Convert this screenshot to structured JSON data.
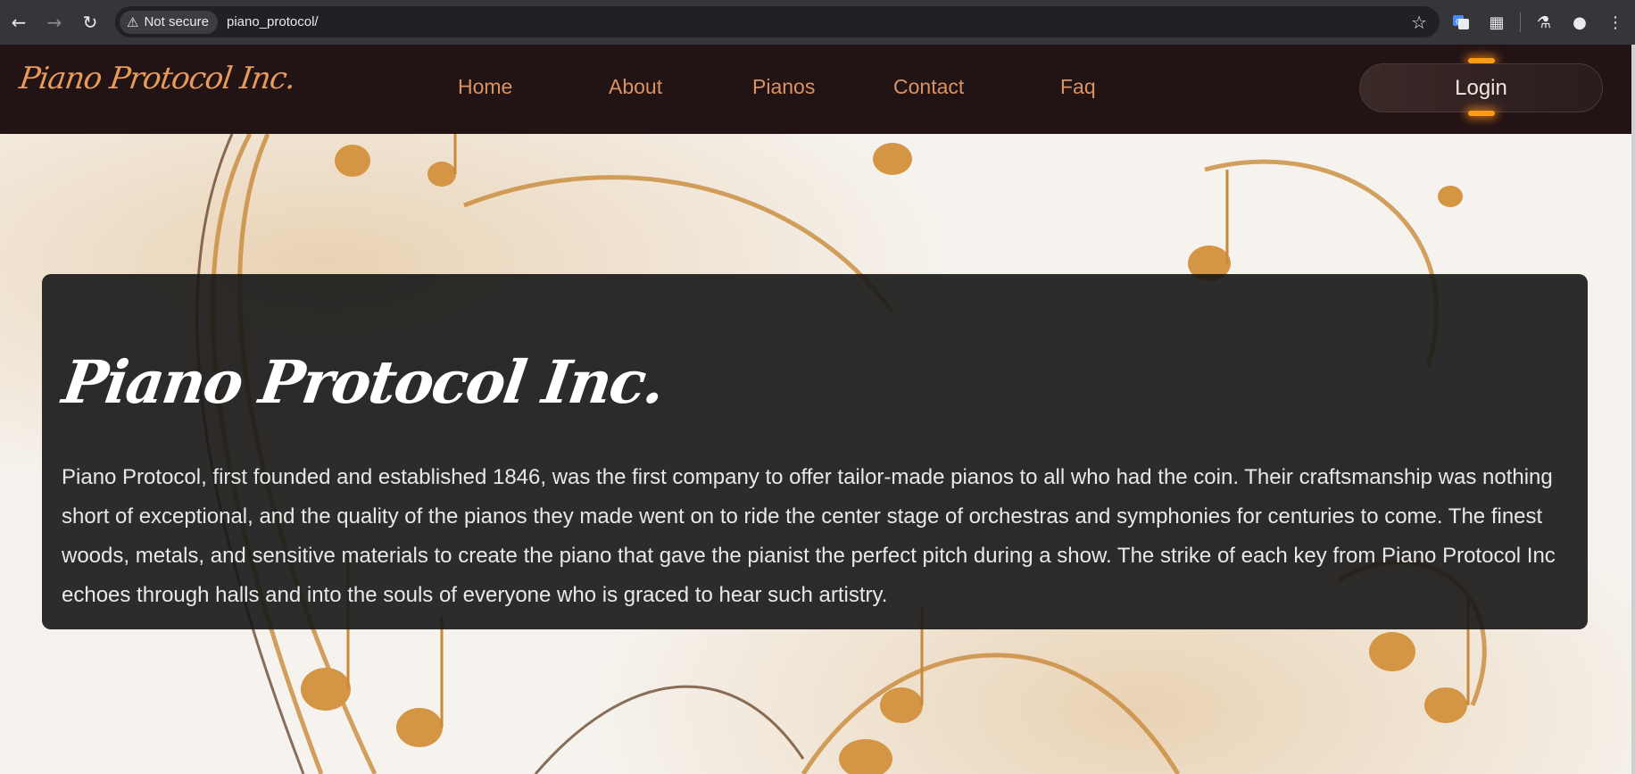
{
  "browser": {
    "security_label": "Not secure",
    "url": "piano_protocol/"
  },
  "site": {
    "logo": "Piano Protocol Inc.",
    "nav": [
      {
        "label": "Home"
      },
      {
        "label": "About"
      },
      {
        "label": "Pianos"
      },
      {
        "label": "Contact"
      },
      {
        "label": "Faq"
      }
    ],
    "login_label": "Login"
  },
  "hero": {
    "title": "Piano Protocol Inc.",
    "body": "Piano Protocol, first founded and established 1846, was the first company to offer tailor-made pianos to all who had the coin. Their craftsmanship was nothing short of exceptional, and the quality of the pianos they made went on to ride the center stage of orchestras and symphonies for centuries to come. The finest woods, metals, and sensitive materials to create the piano that gave the pianist the perfect pitch during a show. The strike of each key from Piano Protocol Inc echoes through halls and into the souls of everyone who is graced to hear such artistry."
  },
  "colors": {
    "header_bg": "#221315",
    "nav_text": "#d99362",
    "accent_glow": "#ff9a1c",
    "card_bg": "#161616"
  },
  "icons": {
    "back": "back-arrow-icon",
    "forward": "forward-arrow-icon",
    "reload": "reload-icon",
    "warning": "warning-triangle-icon",
    "bookmark": "star-icon",
    "translate": "translate-icon",
    "extensions": "puzzle-icon",
    "labs": "flask-icon",
    "profile": "profile-icon",
    "menu": "kebab-menu-icon"
  }
}
